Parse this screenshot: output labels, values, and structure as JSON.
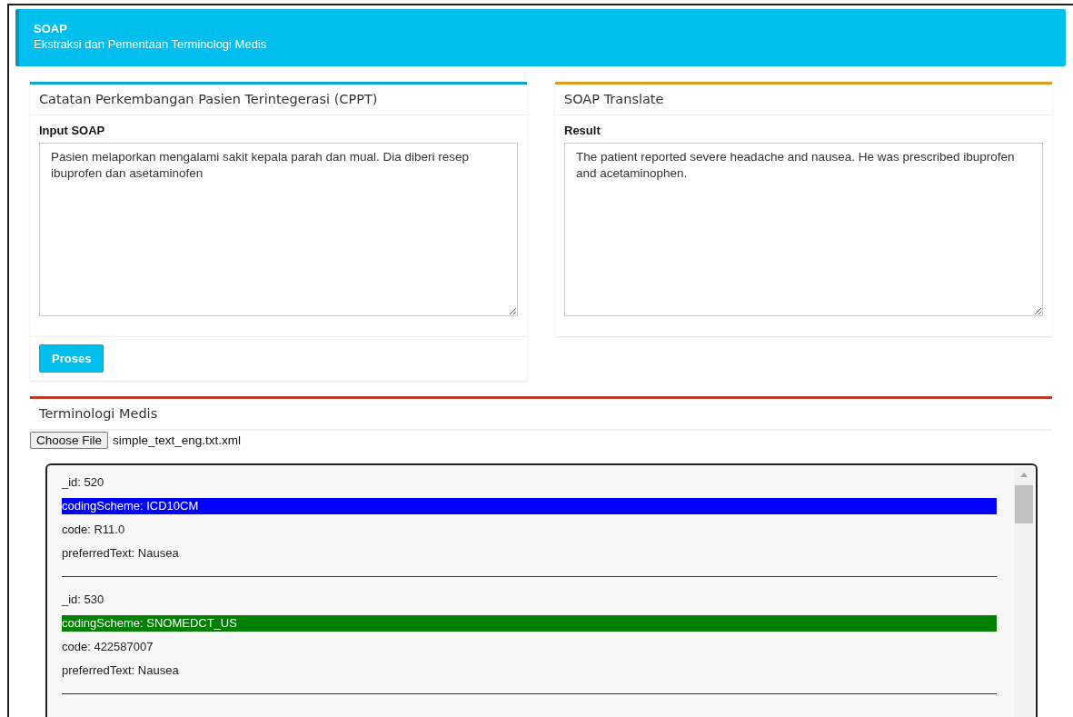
{
  "header": {
    "title": "SOAP",
    "subtitle": "Ekstraksi dan Pementaan Terminologi Medis"
  },
  "input_card": {
    "title": "Catatan Perkembangan Pasien Terintegerasi (CPPT)",
    "field_label": "Input SOAP",
    "value": "Pasien melaporkan mengalami sakit kepala parah dan mual. Dia diberi resep ibuprofen dan asetaminofen",
    "button": "Proses"
  },
  "translate_card": {
    "title": "SOAP Translate",
    "field_label": "Result",
    "value": "The patient reported severe headache and nausea. He was prescribed ibuprofen and acetaminophen."
  },
  "terminology": {
    "title": "Terminologi Medis",
    "file_button": "Choose File",
    "file_name": "simple_text_eng.txt.xml",
    "entries": [
      {
        "id_text": "_id: 520",
        "coding_scheme": "codingScheme: ICD10CM",
        "color": "#0000ff",
        "code": "code: R11.0",
        "preferred_text": "preferredText: Nausea"
      },
      {
        "id_text": "_id: 530",
        "coding_scheme": "codingScheme: SNOMEDCT_US",
        "color": "#008000",
        "code": "code: 422587007",
        "preferred_text": "preferredText: Nausea"
      }
    ]
  }
}
